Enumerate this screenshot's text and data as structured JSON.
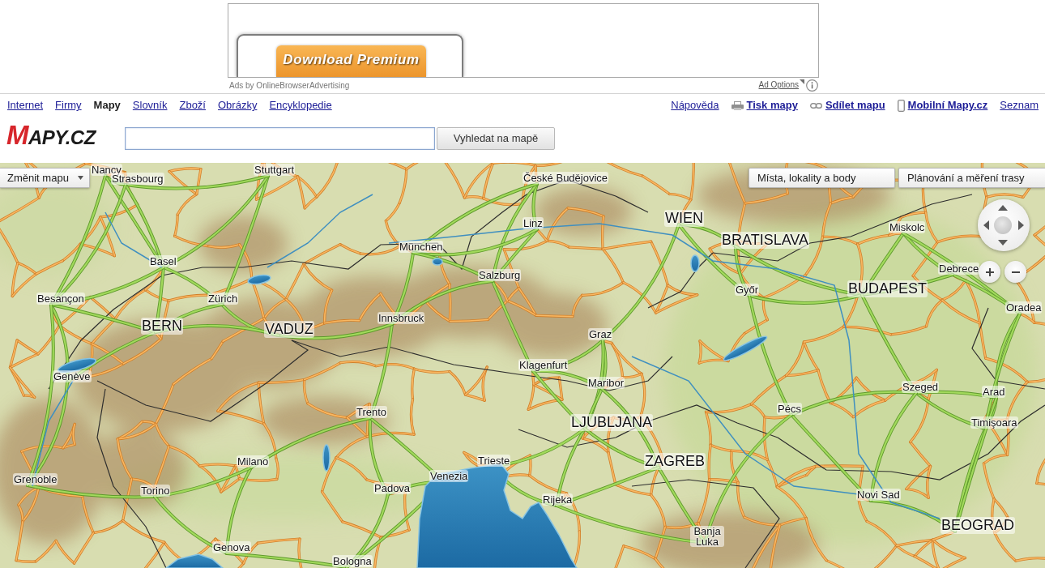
{
  "ad": {
    "button": "Download Premium",
    "attribution": "Ads by OnlineBrowserAdvertising",
    "options_link": "Ad Options"
  },
  "nav": {
    "left": [
      {
        "label": "Internet",
        "selected": false
      },
      {
        "label": "Firmy",
        "selected": false
      },
      {
        "label": "Mapy",
        "selected": true
      },
      {
        "label": "Slovník",
        "selected": false
      },
      {
        "label": "Zboží",
        "selected": false
      },
      {
        "label": "Obrázky",
        "selected": false
      },
      {
        "label": "Encyklopedie",
        "selected": false
      }
    ],
    "right": [
      {
        "label": "Nápověda",
        "kind": "plain"
      },
      {
        "label": "Tisk mapy",
        "kind": "print"
      },
      {
        "label": "Sdílet mapu",
        "kind": "share"
      },
      {
        "label": "Mobilní Mapy.cz",
        "kind": "mobile"
      },
      {
        "label": "Seznam",
        "kind": "plain"
      }
    ]
  },
  "logo": "MAPY.CZ",
  "search": {
    "button": "Vyhledat na mapě"
  },
  "map": {
    "change_map_button": "Změnit mapu",
    "panels": [
      "Místa, lokality a body",
      "Plánování a měření trasy"
    ],
    "labels": [
      {
        "text": "Nancy",
        "kind": "city"
      },
      {
        "text": "Stuttgart",
        "kind": "city"
      },
      {
        "text": "Strasbourg",
        "kind": "city"
      },
      {
        "text": "České Budějovice",
        "kind": "city"
      },
      {
        "text": "WIEN",
        "kind": "capital"
      },
      {
        "text": "Linz",
        "kind": "city"
      },
      {
        "text": "Miskolc",
        "kind": "city"
      },
      {
        "text": "BRATISLAVA",
        "kind": "capital"
      },
      {
        "text": "München",
        "kind": "city"
      },
      {
        "text": "Basel",
        "kind": "city"
      },
      {
        "text": "Debrece",
        "kind": "city"
      },
      {
        "text": "Salzburg",
        "kind": "city"
      },
      {
        "text": "Győr",
        "kind": "city"
      },
      {
        "text": "BUDAPEST",
        "kind": "capital"
      },
      {
        "text": "Besançon",
        "kind": "city"
      },
      {
        "text": "Zürich",
        "kind": "city"
      },
      {
        "text": "Oradea",
        "kind": "city"
      },
      {
        "text": "Innsbruck",
        "kind": "city"
      },
      {
        "text": "BERN",
        "kind": "capital"
      },
      {
        "text": "VADUZ",
        "kind": "capital"
      },
      {
        "text": "Graz",
        "kind": "city"
      },
      {
        "text": "Klagenfurt",
        "kind": "city"
      },
      {
        "text": "Genève",
        "kind": "city"
      },
      {
        "text": "Maribor",
        "kind": "city"
      },
      {
        "text": "Szeged",
        "kind": "city"
      },
      {
        "text": "Arad",
        "kind": "city"
      },
      {
        "text": "Trento",
        "kind": "city"
      },
      {
        "text": "Pécs",
        "kind": "city"
      },
      {
        "text": "LJUBLJANA",
        "kind": "capital"
      },
      {
        "text": "Timişoara",
        "kind": "city"
      },
      {
        "text": "Milano",
        "kind": "city"
      },
      {
        "text": "Trieste",
        "kind": "city"
      },
      {
        "text": "ZAGREB",
        "kind": "capital"
      },
      {
        "text": "Grenoble",
        "kind": "city"
      },
      {
        "text": "Venezia",
        "kind": "city"
      },
      {
        "text": "Torino",
        "kind": "city"
      },
      {
        "text": "Padova",
        "kind": "city"
      },
      {
        "text": "Rijeka",
        "kind": "city"
      },
      {
        "text": "Novi Sad",
        "kind": "city"
      },
      {
        "text": "BEOGRAD",
        "kind": "capital"
      },
      {
        "text": "Banja Luka",
        "kind": "city"
      },
      {
        "text": "Genova",
        "kind": "city"
      },
      {
        "text": "Bologna",
        "kind": "city"
      }
    ]
  }
}
